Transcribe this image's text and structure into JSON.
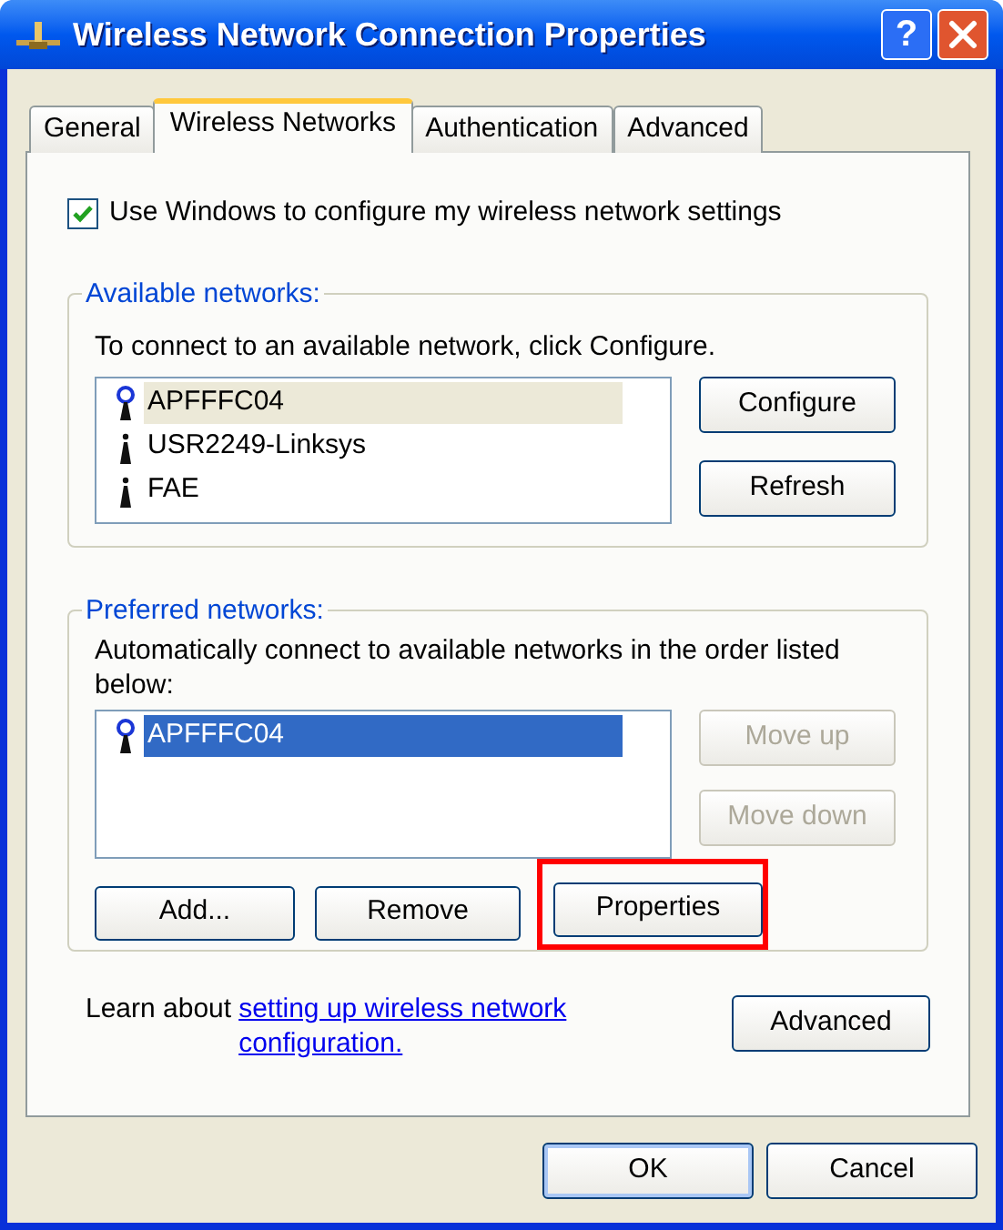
{
  "window": {
    "title": "Wireless Network Connection Properties"
  },
  "title_buttons": [
    {
      "kind": "help",
      "label": "?"
    },
    {
      "kind": "close"
    }
  ],
  "tabs": [
    {
      "label": "General",
      "selected": false
    },
    {
      "label": "Wireless Networks",
      "selected": true
    },
    {
      "label": "Authentication",
      "selected": false
    },
    {
      "label": "Advanced",
      "selected": false
    }
  ],
  "use_windows": {
    "label": "Use Windows to configure my wireless network settings",
    "checked": true
  },
  "available_networks": {
    "title": "Available networks:",
    "hint": "To connect to an available network, click Configure.",
    "focused": false,
    "items": [
      {
        "name": "APFFFC04",
        "kind": "preferred",
        "selected": true
      },
      {
        "name": "USR2249-Linksys",
        "kind": "plain",
        "selected": false
      },
      {
        "name": "FAE",
        "kind": "plain",
        "selected": false
      }
    ],
    "buttons": [
      {
        "label": "Configure",
        "disabled": false
      },
      {
        "label": "Refresh",
        "disabled": false
      }
    ]
  },
  "preferred_networks": {
    "title": "Preferred networks:",
    "hint": "Automatically connect to available networks in the order listed below:",
    "focused": true,
    "items": [
      {
        "name": "APFFFC04",
        "kind": "preferred",
        "selected": true
      }
    ],
    "side_buttons": [
      {
        "label": "Move up",
        "disabled": true
      },
      {
        "label": "Move down",
        "disabled": true
      }
    ],
    "bottom_buttons": [
      {
        "label": "Add...",
        "highlighted": false
      },
      {
        "label": "Remove",
        "highlighted": false
      },
      {
        "label": "Properties",
        "highlighted": true
      }
    ]
  },
  "learn": {
    "text": "Learn about",
    "link": "setting up wireless network configuration."
  },
  "advanced_button": {
    "label": "Advanced"
  },
  "footer_buttons": [
    {
      "label": "OK",
      "default": true
    },
    {
      "label": "Cancel",
      "default": false
    }
  ]
}
